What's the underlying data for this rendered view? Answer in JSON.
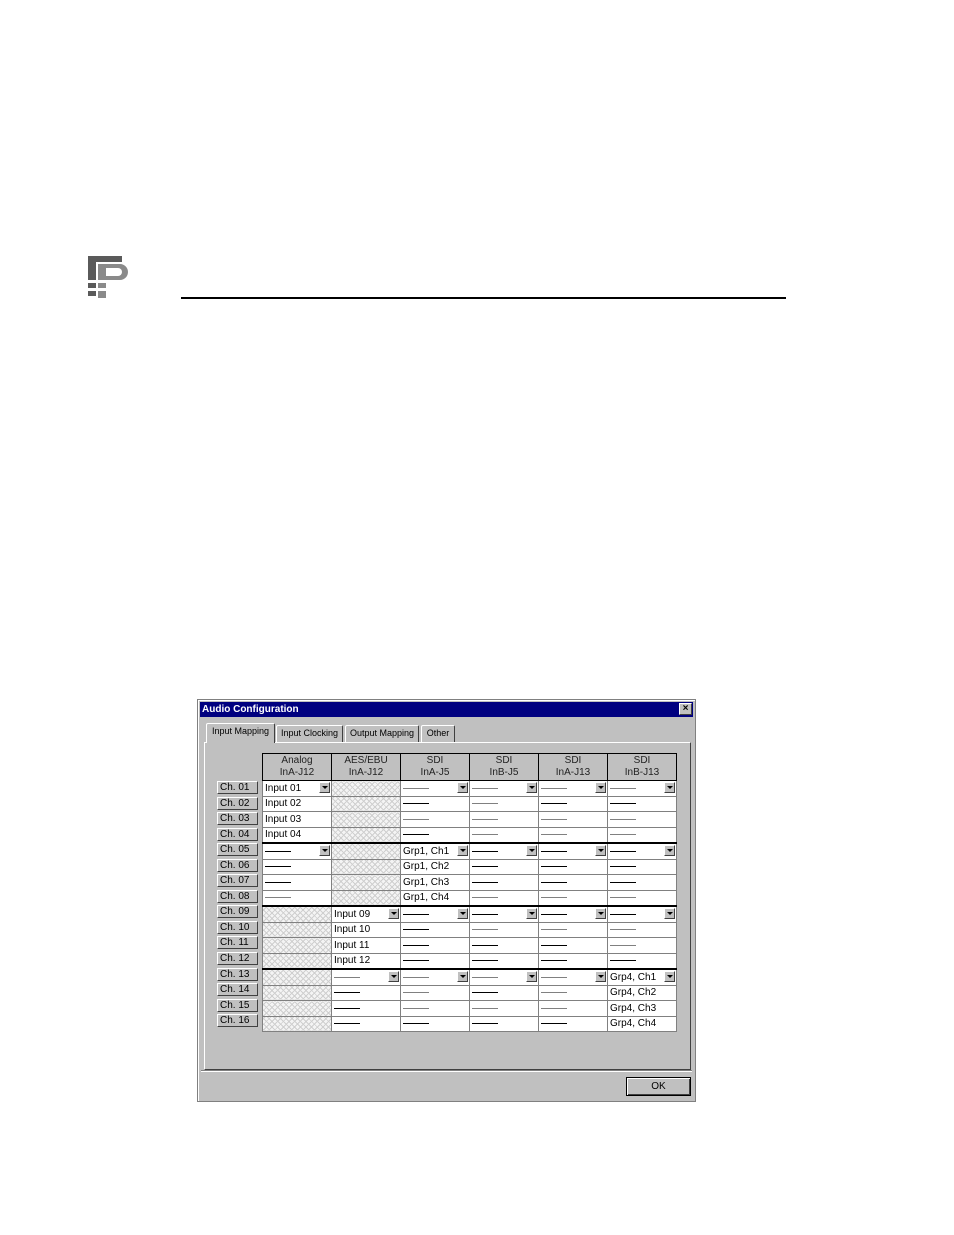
{
  "dialog": {
    "title": "Audio Configuration",
    "close_symbol": "×",
    "ok_label": "OK",
    "tabs": [
      {
        "label": "Input Mapping",
        "active": true
      },
      {
        "label": "Input Clocking",
        "active": false
      },
      {
        "label": "Output Mapping",
        "active": false
      },
      {
        "label": "Other",
        "active": false
      }
    ]
  },
  "columns": [
    {
      "line1": "Analog",
      "line2": "InA-J12"
    },
    {
      "line1": "AES/EBU",
      "line2": "InA-J12"
    },
    {
      "line1": "SDI",
      "line2": "InA-J5"
    },
    {
      "line1": "SDI",
      "line2": "InB-J5"
    },
    {
      "line1": "SDI",
      "line2": "InA-J13"
    },
    {
      "line1": "SDI",
      "line2": "InB-J13"
    }
  ],
  "channels": [
    "Ch. 01",
    "Ch. 02",
    "Ch. 03",
    "Ch. 04",
    "Ch. 05",
    "Ch. 06",
    "Ch. 07",
    "Ch. 08",
    "Ch. 09",
    "Ch. 10",
    "Ch. 11",
    "Ch. 12",
    "Ch. 13",
    "Ch. 14",
    "Ch. 15",
    "Ch. 16"
  ],
  "rows": [
    [
      {
        "t": "Input 01",
        "d": true
      },
      {
        "h": true
      },
      {
        "dash": "gray",
        "d": true
      },
      {
        "dash": "gray",
        "d": true
      },
      {
        "dash": "gray",
        "d": true
      },
      {
        "dash": "gray",
        "d": true
      }
    ],
    [
      {
        "t": "Input 02"
      },
      {
        "h": true
      },
      {
        "dash": "black"
      },
      {
        "dash": "gray"
      },
      {
        "dash": "black"
      },
      {
        "dash": "black"
      }
    ],
    [
      {
        "t": "Input 03"
      },
      {
        "h": true
      },
      {
        "dash": "gray"
      },
      {
        "dash": "gray"
      },
      {
        "dash": "gray"
      },
      {
        "dash": "gray"
      }
    ],
    [
      {
        "t": "Input 04"
      },
      {
        "h": true
      },
      {
        "dash": "black"
      },
      {
        "dash": "gray"
      },
      {
        "dash": "gray"
      },
      {
        "dash": "gray"
      }
    ],
    [
      {
        "dash": "black",
        "d": true
      },
      {
        "h": true
      },
      {
        "t": "Grp1, Ch1",
        "d": true
      },
      {
        "dash": "black",
        "d": true
      },
      {
        "dash": "black",
        "d": true
      },
      {
        "dash": "black",
        "d": true
      }
    ],
    [
      {
        "dash": "black"
      },
      {
        "h": true
      },
      {
        "t": "Grp1, Ch2"
      },
      {
        "dash": "black"
      },
      {
        "dash": "black"
      },
      {
        "dash": "black"
      }
    ],
    [
      {
        "dash": "black"
      },
      {
        "h": true
      },
      {
        "t": "Grp1, Ch3"
      },
      {
        "dash": "black"
      },
      {
        "dash": "black"
      },
      {
        "dash": "black"
      }
    ],
    [
      {
        "dash": "gray"
      },
      {
        "h": true
      },
      {
        "t": "Grp1, Ch4"
      },
      {
        "dash": "gray"
      },
      {
        "dash": "gray"
      },
      {
        "dash": "gray"
      }
    ],
    [
      {
        "h": true
      },
      {
        "t": "Input 09",
        "d": true
      },
      {
        "dash": "black",
        "d": true
      },
      {
        "dash": "black",
        "d": true
      },
      {
        "dash": "black",
        "d": true
      },
      {
        "dash": "black",
        "d": true
      }
    ],
    [
      {
        "h": true
      },
      {
        "t": "Input 10"
      },
      {
        "dash": "black"
      },
      {
        "dash": "gray"
      },
      {
        "dash": "gray"
      },
      {
        "dash": "gray"
      }
    ],
    [
      {
        "h": true
      },
      {
        "t": "Input 11"
      },
      {
        "dash": "black"
      },
      {
        "dash": "black"
      },
      {
        "dash": "black"
      },
      {
        "dash": "gray"
      }
    ],
    [
      {
        "h": true
      },
      {
        "t": "Input 12"
      },
      {
        "dash": "black"
      },
      {
        "dash": "black"
      },
      {
        "dash": "black"
      },
      {
        "dash": "black"
      }
    ],
    [
      {
        "h": true
      },
      {
        "dash": "gray",
        "d": true
      },
      {
        "dash": "gray",
        "d": true
      },
      {
        "dash": "gray",
        "d": true
      },
      {
        "dash": "gray",
        "d": true
      },
      {
        "t": "Grp4, Ch1",
        "d": true
      }
    ],
    [
      {
        "h": true
      },
      {
        "dash": "black"
      },
      {
        "dash": "gray"
      },
      {
        "dash": "black"
      },
      {
        "dash": "gray"
      },
      {
        "t": "Grp4, Ch2"
      }
    ],
    [
      {
        "h": true
      },
      {
        "dash": "black"
      },
      {
        "dash": "gray"
      },
      {
        "dash": "gray"
      },
      {
        "dash": "gray"
      },
      {
        "t": "Grp4, Ch3"
      }
    ],
    [
      {
        "h": true
      },
      {
        "dash": "black"
      },
      {
        "dash": "black"
      },
      {
        "dash": "black"
      },
      {
        "dash": "black"
      },
      {
        "t": "Grp4, Ch4"
      }
    ]
  ]
}
